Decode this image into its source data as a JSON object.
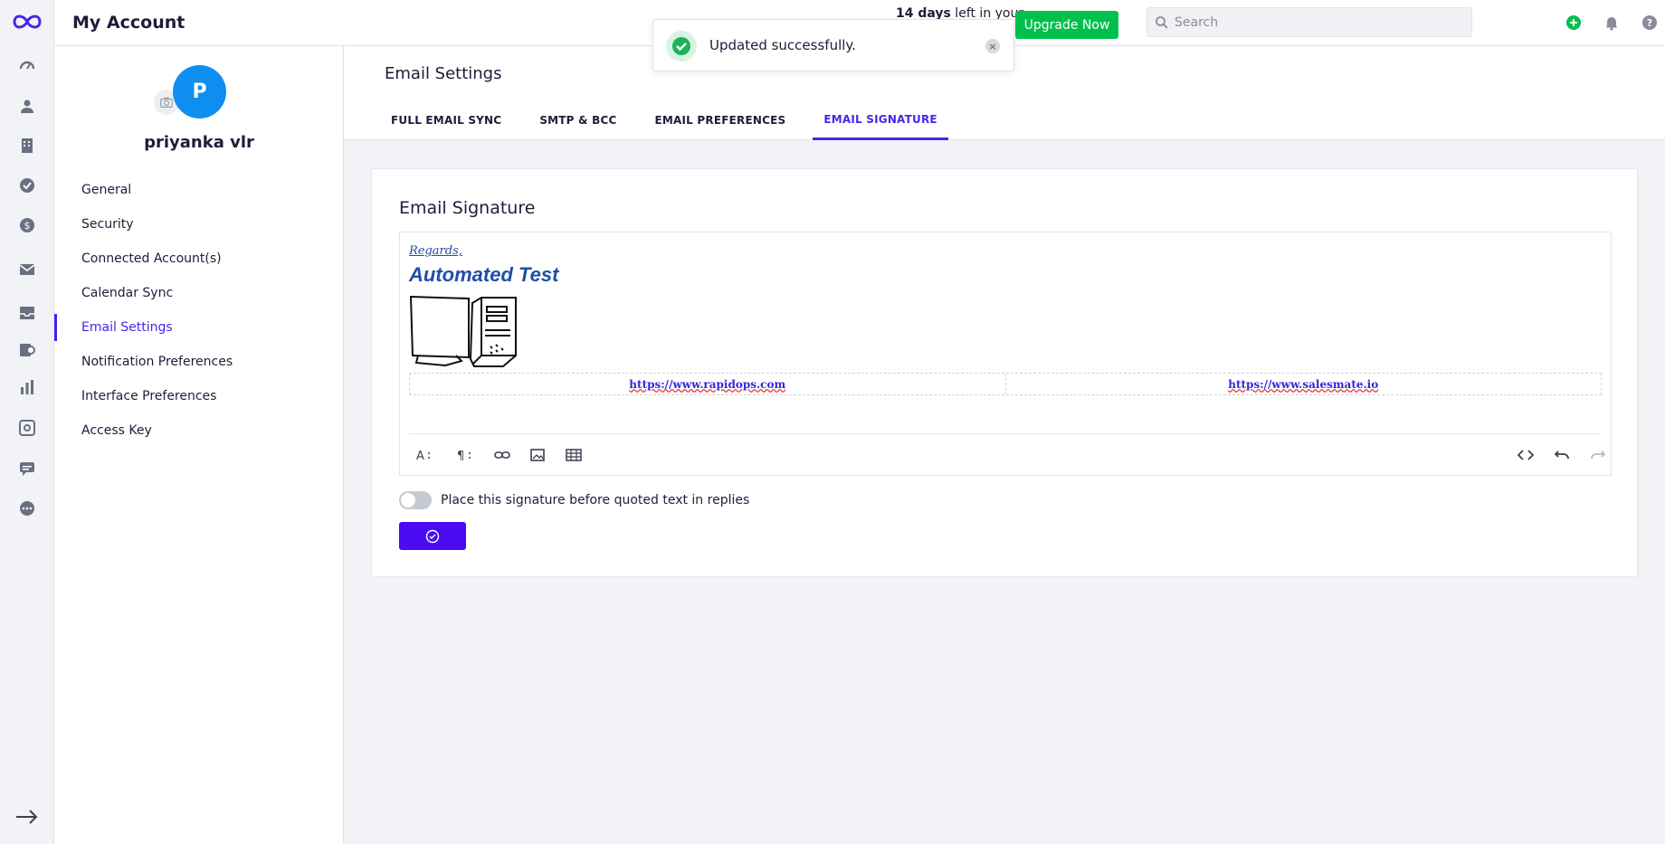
{
  "topbar": {
    "title": "My Account",
    "trial_bold": "14 days",
    "trial_rest": " left in your",
    "upgrade_label": "Upgrade Now",
    "search_placeholder": "Search",
    "avatar_initial": "P"
  },
  "toast": {
    "message": "Updated successfully.",
    "close_symbol": "×"
  },
  "profile": {
    "avatar_initial": "P",
    "name": "priyanka vlr"
  },
  "account_menu": [
    {
      "label": "General",
      "active": false
    },
    {
      "label": "Security",
      "active": false
    },
    {
      "label": "Connected Account(s)",
      "active": false
    },
    {
      "label": "Calendar Sync",
      "active": false
    },
    {
      "label": "Email Settings",
      "active": true
    },
    {
      "label": "Notification Preferences",
      "active": false
    },
    {
      "label": "Interface Preferences",
      "active": false
    },
    {
      "label": "Access Key",
      "active": false
    }
  ],
  "content": {
    "heading": "Email Settings",
    "tabs": [
      {
        "label": "FULL EMAIL SYNC",
        "active": false
      },
      {
        "label": "SMTP & BCC",
        "active": false
      },
      {
        "label": "EMAIL PREFERENCES",
        "active": false
      },
      {
        "label": "EMAIL SIGNATURE",
        "active": true
      }
    ]
  },
  "signature": {
    "card_title": "Email Signature",
    "regards": "Regards,",
    "name": "Automated Test",
    "links": [
      "https://www.rapidops.com",
      "https://www.salesmate.io"
    ],
    "toggle_label": "Place this signature before quoted text in replies",
    "toggle_on": false
  },
  "colors": {
    "accent": "#4a24ea",
    "upgrade": "#00c04d",
    "avatar": "#0e8ff0",
    "signature_text": "#1f4ea8"
  }
}
